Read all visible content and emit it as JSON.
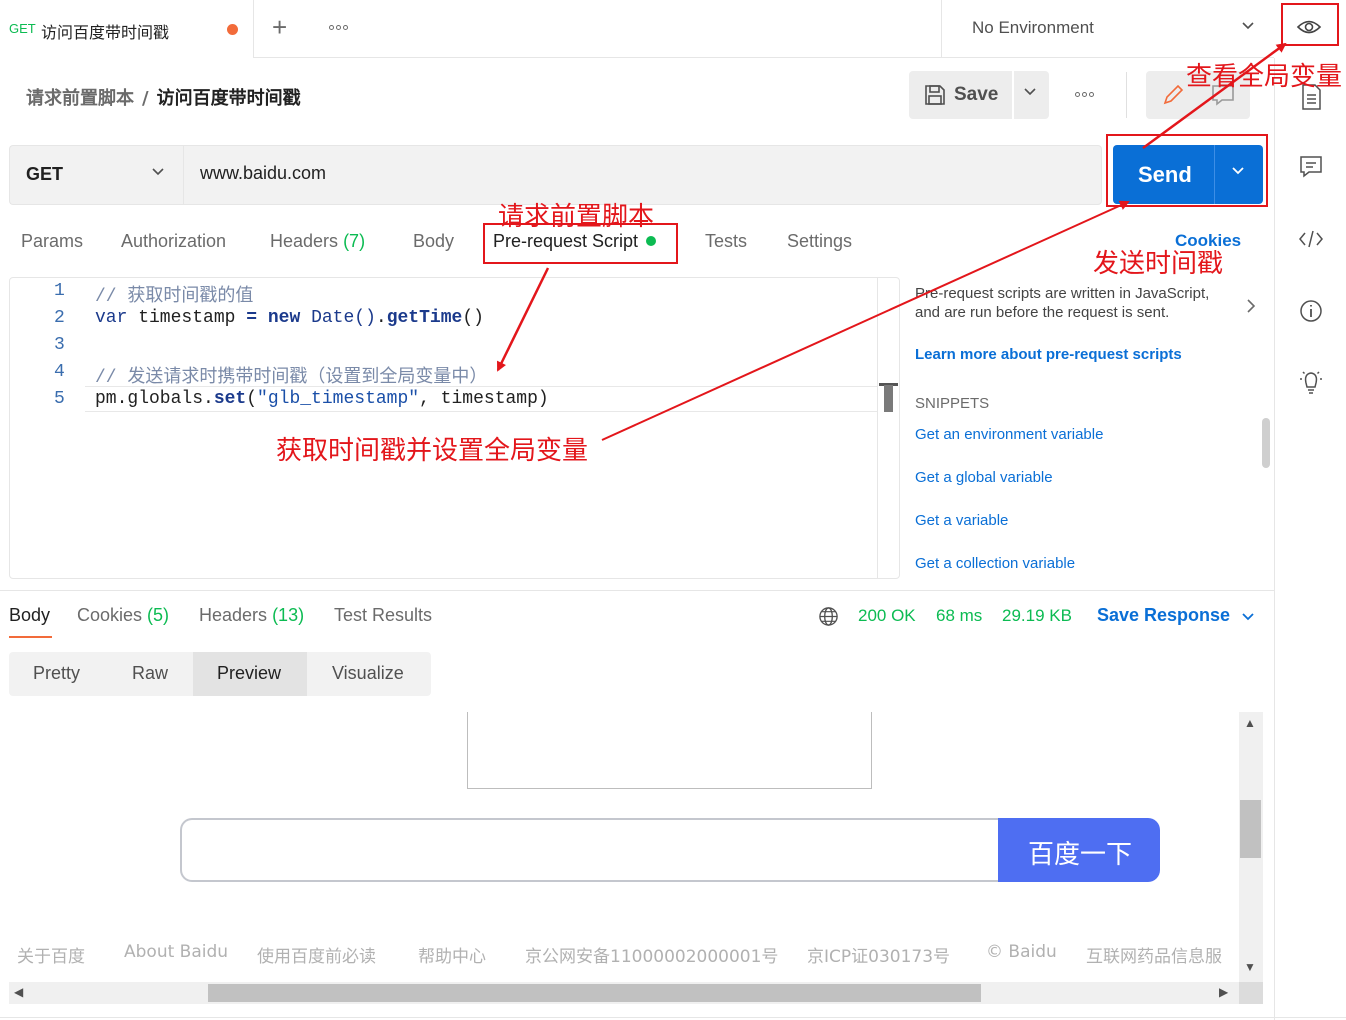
{
  "tab": {
    "method": "GET",
    "title": "访问百度带时间戳"
  },
  "environment": {
    "label": "No Environment"
  },
  "breadcrumb": {
    "collection": "请求前置脚本",
    "separator": "/",
    "request": "访问百度带时间戳"
  },
  "toolbar": {
    "save_label": "Save"
  },
  "request": {
    "method": "GET",
    "url": "www.baidu.com",
    "send_label": "Send"
  },
  "request_tabs": [
    {
      "label": "Params"
    },
    {
      "label": "Authorization"
    },
    {
      "label": "Headers",
      "count": "(7)"
    },
    {
      "label": "Body"
    },
    {
      "label": "Pre-request Script"
    },
    {
      "label": "Tests"
    },
    {
      "label": "Settings"
    }
  ],
  "cookies_link": "Cookies",
  "editor": {
    "line_numbers": [
      "1",
      "2",
      "3",
      "4",
      "5"
    ],
    "line1": "// 获取时间戳的值",
    "line2": {
      "kw": "var",
      "name": " timestamp ",
      "eq": "=",
      "new": " new",
      "cls": " Date()",
      "dot": ".",
      "fn": "getTime",
      "end": "()"
    },
    "line4": "// 发送请求时携带时间戳（设置到全局变量中）",
    "line5": {
      "obj": "pm.globals.",
      "fn": "set",
      "open": "(",
      "str": "\"glb_timestamp\"",
      "rest": ", timestamp",
      "close": ")"
    }
  },
  "help": {
    "text": "Pre-request scripts are written in JavaScript, and are run before the request is sent.",
    "link": "Learn more about pre-request scripts",
    "snippets_title": "SNIPPETS",
    "snippets": [
      "Get an environment variable",
      "Get a global variable",
      "Get a variable",
      "Get a collection variable"
    ]
  },
  "response": {
    "tabs": [
      {
        "label": "Body"
      },
      {
        "label": "Cookies",
        "count": "(5)"
      },
      {
        "label": "Headers",
        "count": "(13)"
      },
      {
        "label": "Test Results"
      }
    ],
    "status": "200 OK",
    "time": "68 ms",
    "size": "29.19 KB",
    "save_label": "Save Response",
    "view_modes": [
      "Pretty",
      "Raw",
      "Preview",
      "Visualize"
    ]
  },
  "preview": {
    "button": "百度一下",
    "footer": [
      "关于百度",
      "About Baidu",
      "使用百度前必读",
      "帮助中心",
      "京公网安备11000002000001号",
      "京ICP证030173号",
      "© Baidu",
      "互联网药品信息服"
    ]
  },
  "annotations": {
    "global_vars": "查看全局变量",
    "pre_script": "请求前置脚本",
    "send": "发送时间戳",
    "get_set": "获取时间戳并设置全局变量"
  },
  "colors": {
    "accent": "#f26b3a",
    "send": "#0a6fd6",
    "success": "#0cbb52",
    "annotation": "#e3161b",
    "baidu_blue": "#4e6ef2"
  }
}
